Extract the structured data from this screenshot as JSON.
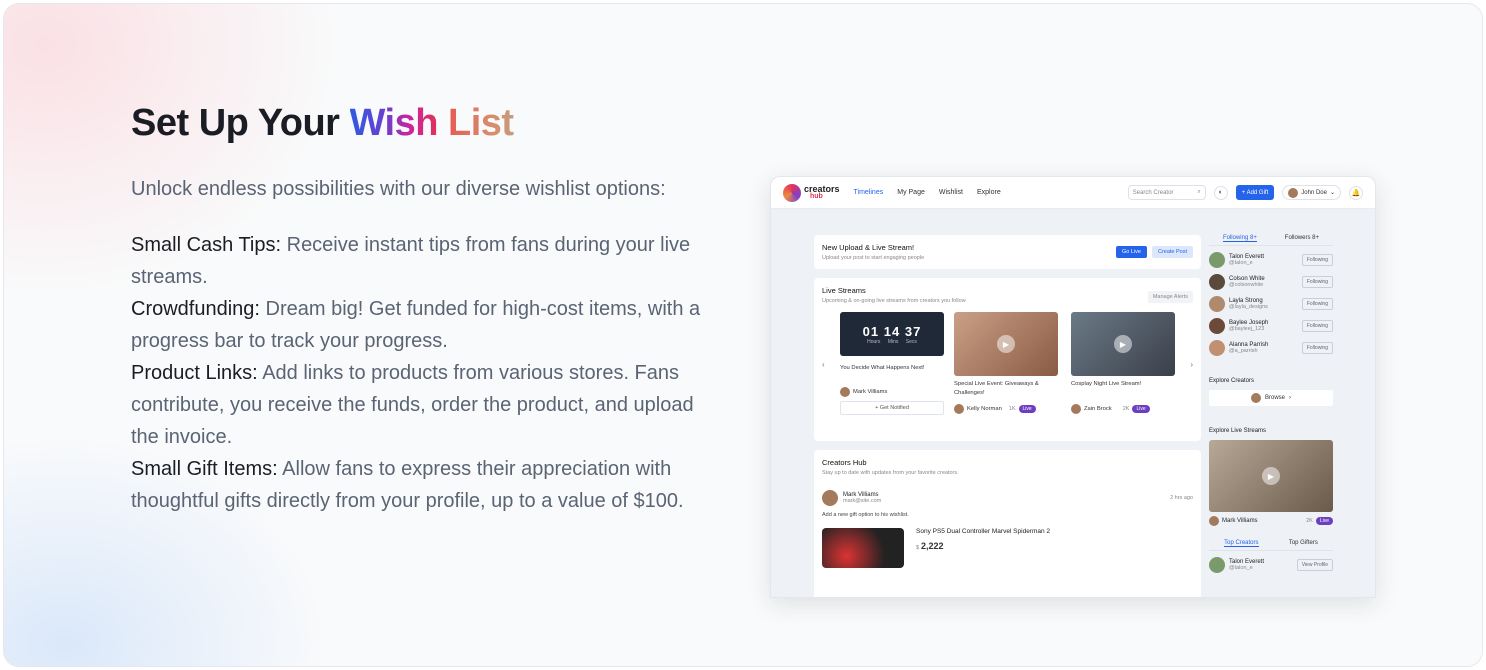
{
  "hero": {
    "title_part1": "Set Up Your ",
    "title_wish": "Wish",
    "title_space": " ",
    "title_list": "List",
    "intro": "Unlock endless possibilities with our diverse wishlist options:",
    "features": [
      {
        "label": "Small Cash Tips:",
        "text": " Receive instant tips from fans during your live streams."
      },
      {
        "label": "Crowdfunding:",
        "text": " Dream big! Get funded for high-cost items, with a progress bar to track your progress."
      },
      {
        "label": "Product Links:",
        "text": " Add links to products from various stores. Fans contribute, you receive the funds, order the product, and upload the invoice."
      },
      {
        "label": "Small Gift Items:",
        "text": " Allow fans to express their appreciation with thoughtful gifts directly from your profile, up to a value of $100."
      }
    ]
  },
  "app": {
    "logo_top": "creators",
    "logo_bottom": "hub",
    "nav": [
      "Timelines",
      "My Page",
      "Wishlist",
      "Explore"
    ],
    "search_placeholder": "Search Creator",
    "add_gift": "+ Add Gift",
    "user_name": "John Doe",
    "upload": {
      "title": "New Upload & Live Stream!",
      "sub": "Upload your post to start engaging people",
      "go_live": "Go Live",
      "create_post": "Create Post"
    },
    "live_streams": {
      "title": "Live Streams",
      "sub": "Upcoming & on-going live streams from creators you follow",
      "manage": "Manage Alerts",
      "timer": {
        "h": "01",
        "m": "14",
        "s": "37",
        "units": "Hours Mins Secs"
      },
      "upcoming_title": "You Decide What Happens Next!",
      "upcoming_creator": "Mark Villiams",
      "get_notified": "+ Get Notified",
      "streams": [
        {
          "title": "Special Live Event: Giveaways & Challenges!",
          "creator": "Kelly Norman",
          "viewers": "1K",
          "badge": "Live"
        },
        {
          "title": "Cosplay Night Live Stream!",
          "creator": "Zain Brock",
          "viewers": "2K",
          "badge": "Live"
        }
      ]
    },
    "hub": {
      "title": "Creators Hub",
      "sub": "Stay up to date with updates from your favorite creators.",
      "post_name": "Mark Villiams",
      "post_email": "mark@site.com",
      "post_time": "2 hrs ago",
      "post_text": "Add a new gift option to his wishlist.",
      "product_name": "Sony PS5 Dual Controller Marvel Spiderman 2",
      "product_currency": "$",
      "product_price": "2,222"
    },
    "sidebar": {
      "tab_following": "Following",
      "tab_following_count": "8+",
      "tab_followers": "Followers",
      "tab_followers_count": "8+",
      "following": [
        {
          "name": "Talon Everett",
          "handle": "@talon_e",
          "btn": "Following"
        },
        {
          "name": "Colson White",
          "handle": "@colsonwhite",
          "btn": "Following"
        },
        {
          "name": "Layla Strong",
          "handle": "@layla_designs",
          "btn": "Following"
        },
        {
          "name": "Baylee Joseph",
          "handle": "@bayleej_123",
          "btn": "Following"
        },
        {
          "name": "Alanna Parrish",
          "handle": "@a_parrish",
          "btn": "Following"
        }
      ],
      "explore_creators": "Explore Creators",
      "browse": "Browse",
      "explore_streams": "Explore Live Streams",
      "explore_stream_creator": "Mark Villiams",
      "explore_stream_viewers": "2K",
      "explore_stream_badge": "Live",
      "tab_top_creators": "Top Creators",
      "tab_top_gifters": "Top Gifters",
      "top_creator_name": "Talon Everett",
      "top_creator_handle": "@talon_e",
      "view_profile": "View Profile"
    }
  }
}
